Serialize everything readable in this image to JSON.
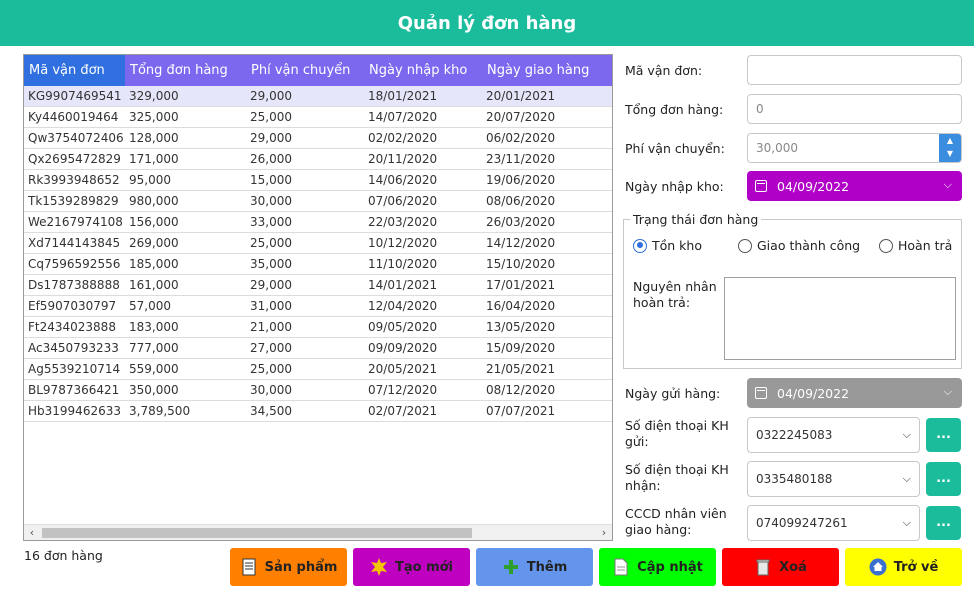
{
  "app": {
    "title": "Quản lý đơn hàng"
  },
  "table": {
    "columns": [
      "Mã vận đơn",
      "Tổng đơn hàng",
      "Phí vận chuyển",
      "Ngày nhập kho",
      "Ngày giao hàng"
    ],
    "rows": [
      [
        "KG9907469541",
        "329,000",
        "29,000",
        "18/01/2021",
        "20/01/2021"
      ],
      [
        "Ky4460019464",
        "325,000",
        "25,000",
        "14/07/2020",
        "20/07/2020"
      ],
      [
        "Qw3754072406",
        "128,000",
        "29,000",
        "02/02/2020",
        "06/02/2020"
      ],
      [
        "Qx2695472829",
        "171,000",
        "26,000",
        "20/11/2020",
        "23/11/2020"
      ],
      [
        "Rk3993948652",
        "95,000",
        "15,000",
        "14/06/2020",
        "19/06/2020"
      ],
      [
        "Tk1539289829",
        "980,000",
        "30,000",
        "07/06/2020",
        "08/06/2020"
      ],
      [
        "We2167974108",
        "156,000",
        "33,000",
        "22/03/2020",
        "26/03/2020"
      ],
      [
        "Xd7144143845",
        "269,000",
        "25,000",
        "10/12/2020",
        "14/12/2020"
      ],
      [
        "Cq7596592556",
        "185,000",
        "35,000",
        "11/10/2020",
        "15/10/2020"
      ],
      [
        "Ds1787388888",
        "161,000",
        "29,000",
        "14/01/2021",
        "17/01/2021"
      ],
      [
        "Ef5907030797",
        "57,000",
        "31,000",
        "12/04/2020",
        "16/04/2020"
      ],
      [
        "Ft2434023888",
        "183,000",
        "21,000",
        "09/05/2020",
        "13/05/2020"
      ],
      [
        "Ac3450793233",
        "777,000",
        "27,000",
        "09/09/2020",
        "15/09/2020"
      ],
      [
        "Ag5539210714",
        "559,000",
        "25,000",
        "20/05/2021",
        "21/05/2021"
      ],
      [
        "BL9787366421",
        "350,000",
        "30,000",
        "07/12/2020",
        "08/12/2020"
      ],
      [
        "Hb3199462633",
        "3,789,500",
        "34,500",
        "02/07/2021",
        "07/07/2021"
      ]
    ],
    "selected_row": 0,
    "count_label": "16 đơn hàng"
  },
  "form": {
    "ma_van_don": {
      "label": "Mã vận đơn:",
      "value": ""
    },
    "tong_don_hang": {
      "label": "Tổng đơn hàng:",
      "value": "0"
    },
    "phi_van_chuyen": {
      "label": "Phí vận chuyển:",
      "value": "30,000"
    },
    "ngay_nhap_kho": {
      "label": "Ngày nhập kho:",
      "value": "04/09/2022",
      "color": "#b000c8"
    },
    "trang_thai": {
      "title": "Trạng thái đơn hàng",
      "options": [
        "Tồn kho",
        "Giao thành công",
        "Hoàn trả"
      ],
      "selected": "Tồn kho",
      "reason_label_1": "Nguyên nhân",
      "reason_label_2": "hoàn trả:"
    },
    "ngay_gui_hang": {
      "label": "Ngày gửi hàng:",
      "value": "04/09/2022",
      "color": "#999999"
    },
    "sdt_gui": {
      "label_1": "Số điện thoại KH",
      "label_2": "gửi:",
      "value": "0322245083"
    },
    "sdt_nhan": {
      "label_1": "Số điện thoại KH",
      "label_2": "nhận:",
      "value": "0335480188"
    },
    "cccd": {
      "label_1": "CCCD nhân viên",
      "label_2": "giao hàng:",
      "value": "074099247261"
    },
    "dots_label": "..."
  },
  "buttons": {
    "san_pham": {
      "label": "Sản phẩm",
      "color": "#ff8000",
      "icon": "document-icon"
    },
    "tao_moi": {
      "label": "Tạo mới",
      "color": "#c000c0",
      "icon": "new-badge-icon"
    },
    "them": {
      "label": "Thêm",
      "color": "#6495ed",
      "icon": "plus-icon"
    },
    "cap_nhat": {
      "label": "Cập nhật",
      "color": "#00ff00",
      "icon": "edit-document-icon"
    },
    "xoa": {
      "label": "Xoá",
      "color": "#ff0000",
      "icon": "trash-icon"
    },
    "tro_ve": {
      "label": "Trở về",
      "color": "#ffff00",
      "icon": "home-icon"
    }
  },
  "colors": {
    "header": "#1abc9c",
    "grid_header": "#7b68ee",
    "grid_header_first": "#2f6fe0",
    "accent": "#1abc9c"
  }
}
